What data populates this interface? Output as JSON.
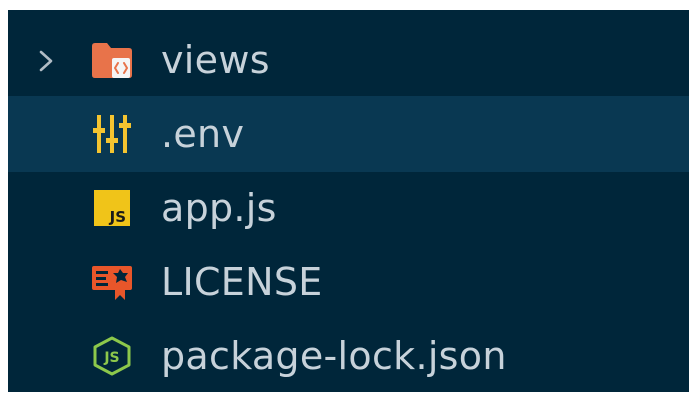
{
  "explorer": {
    "items": [
      {
        "label": "views",
        "kind": "folder",
        "icon": "views-folder-icon",
        "expandable": true,
        "expanded": false,
        "selected": false
      },
      {
        "label": ".env",
        "kind": "file",
        "icon": "env-settings-icon",
        "selected": true
      },
      {
        "label": "app.js",
        "kind": "file",
        "icon": "javascript-icon",
        "selected": false
      },
      {
        "label": "LICENSE",
        "kind": "file",
        "icon": "license-icon",
        "selected": false
      },
      {
        "label": "package-lock.json",
        "kind": "file",
        "icon": "nodejs-icon",
        "selected": false
      }
    ]
  },
  "colors": {
    "background": "#00263a",
    "selected_row": "#093852",
    "text": "#c7d2da",
    "folder": "#e8734a",
    "env": "#f4c430",
    "js_badge": "#f0c419",
    "license": "#e8562a",
    "node": "#8cc84b"
  }
}
